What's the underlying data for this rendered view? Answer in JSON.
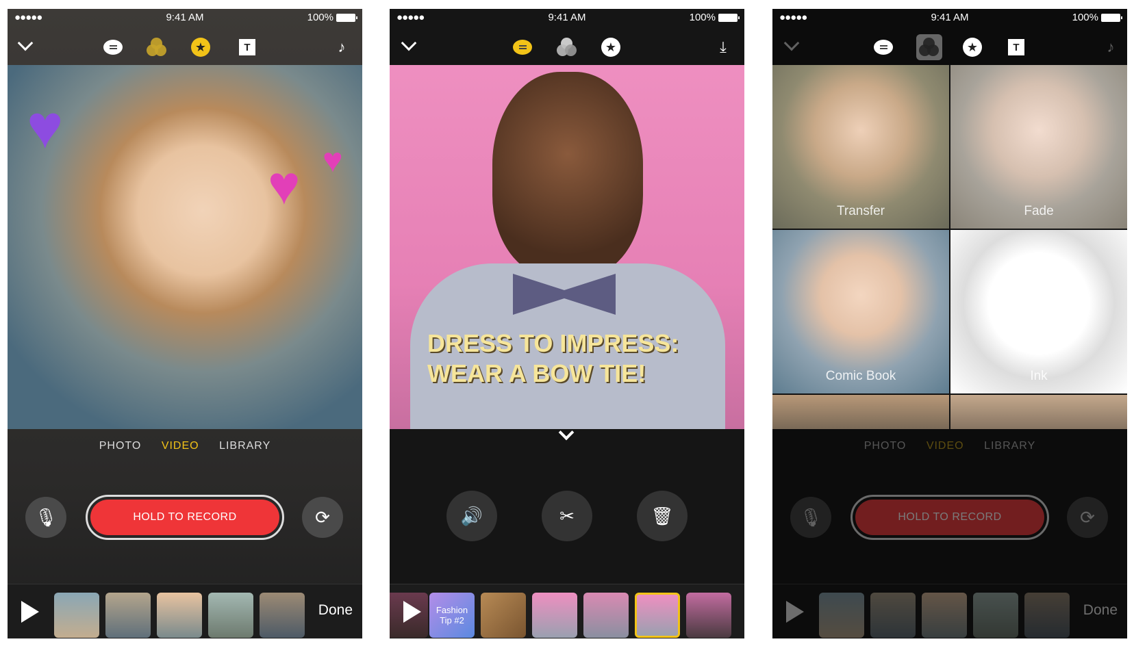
{
  "status": {
    "time": "9:41 AM",
    "battery": "100%",
    "signal": "●●●●●"
  },
  "phone1": {
    "toolbar_icons": [
      "chevron-down-icon",
      "speech-bubble-icon",
      "filters-icon",
      "star-sticker-icon",
      "text-icon",
      "music-note-icon"
    ],
    "active_color": "#f2c318",
    "modes": [
      "PHOTO",
      "VIDEO",
      "LIBRARY"
    ],
    "active_mode": "VIDEO",
    "record_label": "HOLD TO RECORD",
    "done_label": "Done"
  },
  "phone2": {
    "toolbar_icons": [
      "chevron-down-icon",
      "speech-bubble-icon",
      "filters-icon",
      "star-sticker-icon",
      "download-icon"
    ],
    "poster_text": [
      "DRESS TO IMPRESS:",
      "WEAR A BOW TIE!"
    ],
    "controls": [
      "speaker-icon",
      "scissors-icon",
      "trash-icon"
    ],
    "clip_title": "Fashion Tip #2"
  },
  "phone3": {
    "filters": [
      "Transfer",
      "Fade",
      "Comic Book",
      "Ink"
    ],
    "modes": [
      "PHOTO",
      "VIDEO",
      "LIBRARY"
    ],
    "record_label": "HOLD TO RECORD",
    "done_label": "Done"
  }
}
